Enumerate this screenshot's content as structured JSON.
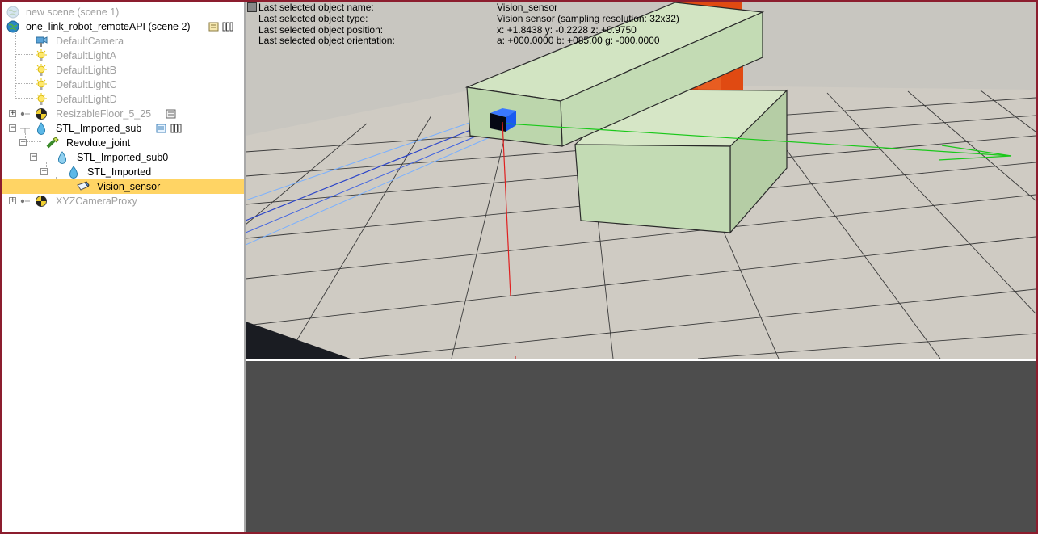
{
  "hierarchy": {
    "items": [
      {
        "label": "new scene (scene 1)",
        "icon": "globe-icon",
        "dimmed": true
      },
      {
        "label": "one_link_robot_remoteAPI (scene 2)",
        "icon": "globe-icon",
        "dimmed": false
      },
      {
        "label": "DefaultCamera",
        "icon": "camera-icon",
        "dimmed": true
      },
      {
        "label": "DefaultLightA",
        "icon": "light-bulb-icon",
        "dimmed": true
      },
      {
        "label": "DefaultLightB",
        "icon": "light-bulb-icon",
        "dimmed": true
      },
      {
        "label": "DefaultLightC",
        "icon": "light-bulb-icon",
        "dimmed": true
      },
      {
        "label": "DefaultLightD",
        "icon": "light-bulb-icon",
        "dimmed": true
      },
      {
        "label": "ResizableFloor_5_25",
        "icon": "dummy-icon",
        "dimmed": true
      },
      {
        "label": "STL_Imported_sub",
        "icon": "shape-icon",
        "dimmed": false
      },
      {
        "label": "Revolute_joint",
        "icon": "joint-icon",
        "dimmed": false
      },
      {
        "label": "STL_Imported_sub0",
        "icon": "shape-icon",
        "dimmed": false
      },
      {
        "label": "STL_Imported",
        "icon": "shape-icon",
        "dimmed": false
      },
      {
        "label": "Vision_sensor",
        "icon": "vision-sensor-icon",
        "dimmed": false,
        "selected": true
      },
      {
        "label": "XYZCameraProxy",
        "icon": "dummy-icon",
        "dimmed": true
      }
    ]
  },
  "viewport": {
    "info": [
      {
        "key": "Last selected object name:",
        "value": "Vision_sensor"
      },
      {
        "key": "Last selected object type:",
        "value": "Vision sensor (sampling resolution: 32x32)"
      },
      {
        "key": "Last selected object position:",
        "value": "x: +1.8438    y: -0.2228    z: +0.9750"
      },
      {
        "key": "Last selected object orientation:",
        "value": "a: +000.0000    b: +085.00    g: -000.0000"
      }
    ]
  },
  "colors": {
    "frame": "#8c1d2e",
    "selection": "#ffd464",
    "link_fill": "#c3dbb4",
    "robot_orange": "#e04a12",
    "floor_light": "#cfcbc3",
    "floor_dark": "#b9b5ad",
    "lower_pane": "#4d4d4d"
  }
}
